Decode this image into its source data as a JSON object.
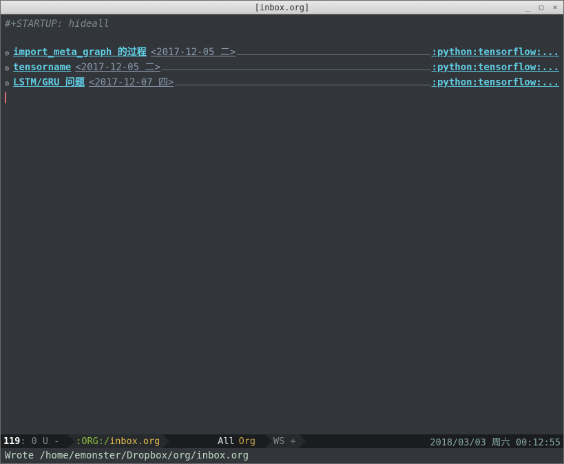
{
  "window": {
    "title": "[inbox.org]"
  },
  "editor": {
    "startup": "#+STARTUP: hideall",
    "headings": [
      {
        "title": "import_meta_graph 的过程",
        "date": "<2017-12-05 二>",
        "tags": ":python:tensorflow:..."
      },
      {
        "title": "tensorname",
        "date": "<2017-12-05 二>",
        "tags": ":python:tensorflow:..."
      },
      {
        "title": "LSTM/GRU 问题",
        "date": "<2017-12-07 四>",
        "tags": ":python:tensorflow:..."
      }
    ]
  },
  "modeline": {
    "line": "119",
    "col": ": 0 U -",
    "mode_prefix": ":ORG:/",
    "buffer": "inbox.org",
    "position": "All",
    "major_mode": "Org",
    "ws": "WS +",
    "datetime": "2018/03/03 周六 00:12:55"
  },
  "echo": {
    "message": "Wrote /home/emonster/Dropbox/org/inbox.org"
  }
}
